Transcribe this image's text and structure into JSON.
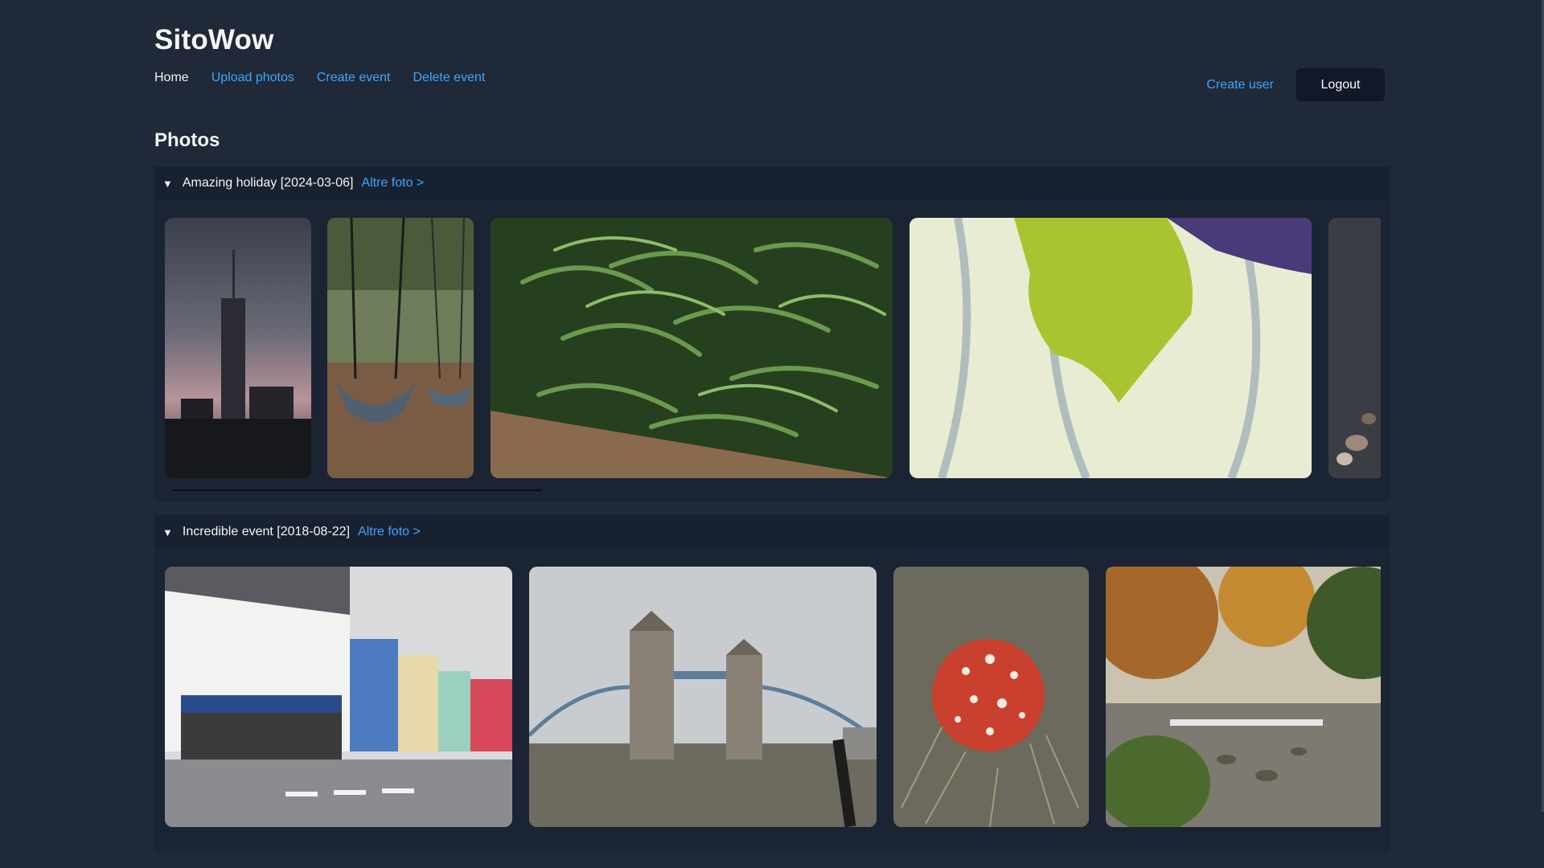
{
  "app": {
    "title": "SitoWow"
  },
  "nav": {
    "home": "Home",
    "upload": "Upload photos",
    "create_event": "Create event",
    "delete_event": "Delete event",
    "create_user": "Create user",
    "logout": "Logout"
  },
  "section": {
    "heading": "Photos"
  },
  "events": [
    {
      "title": "Amazing holiday [2024-03-06]",
      "more": "Altre foto >",
      "photos": [
        {
          "icon": "city-skyline-photo"
        },
        {
          "icon": "playground-swing-photo"
        },
        {
          "icon": "green-beans-photo"
        },
        {
          "icon": "green-leaf-photo"
        },
        {
          "icon": "pebbles-photo"
        }
      ]
    },
    {
      "title": "Incredible event [2018-08-22]",
      "more": "Altre foto >",
      "photos": [
        {
          "icon": "street-shops-photo"
        },
        {
          "icon": "tower-bridge-photo"
        },
        {
          "icon": "red-mushroom-photo"
        },
        {
          "icon": "autumn-river-photo"
        }
      ]
    }
  ],
  "colors": {
    "link": "#3ea6ff",
    "background": "#1f2937",
    "panel": "#1b2432"
  }
}
